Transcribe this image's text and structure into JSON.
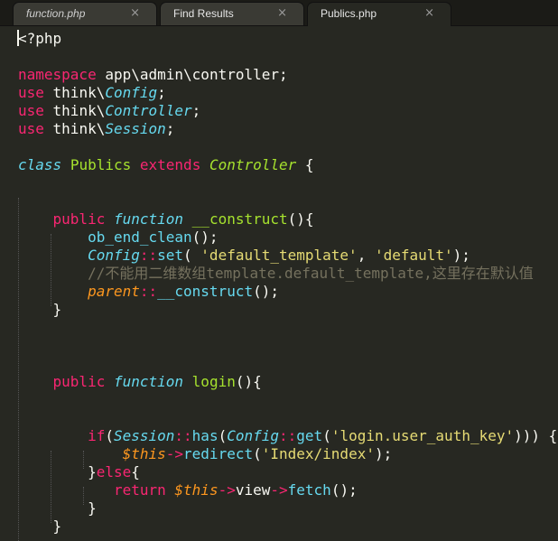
{
  "tabs": [
    {
      "label": "function.php",
      "close": "×"
    },
    {
      "label": "Find Results",
      "close": "×"
    },
    {
      "label": "Publics.php",
      "close": "×"
    }
  ],
  "colors": {
    "background": "#272822",
    "keyword": "#f92672",
    "storage": "#66d9ef",
    "entity": "#a6e22e",
    "string": "#e6db74",
    "comment": "#75715e",
    "variable": "#fd971f",
    "text": "#f8f8f2"
  },
  "code": [
    [
      {
        "t": "<?php",
        "c": "text"
      }
    ],
    [],
    [
      {
        "t": "namespace",
        "c": "keyword"
      },
      {
        "t": " "
      },
      {
        "t": "app\\admin\\controller",
        "c": "text"
      },
      {
        "t": ";"
      }
    ],
    [
      {
        "t": "use",
        "c": "keyword"
      },
      {
        "t": " think\\"
      },
      {
        "t": "Config",
        "c": "storage",
        "i": true
      },
      {
        "t": ";"
      }
    ],
    [
      {
        "t": "use",
        "c": "keyword"
      },
      {
        "t": " think\\"
      },
      {
        "t": "Controller",
        "c": "storage",
        "i": true
      },
      {
        "t": ";"
      }
    ],
    [
      {
        "t": "use",
        "c": "keyword"
      },
      {
        "t": " think\\"
      },
      {
        "t": "Session",
        "c": "storage",
        "i": true
      },
      {
        "t": ";"
      }
    ],
    [],
    [
      {
        "t": "class",
        "c": "storage",
        "i": true
      },
      {
        "t": " "
      },
      {
        "t": "Publics",
        "c": "entity"
      },
      {
        "t": " "
      },
      {
        "t": "extends",
        "c": "keyword"
      },
      {
        "t": " "
      },
      {
        "t": "Controller",
        "c": "entity",
        "i": true
      },
      {
        "t": " {"
      }
    ],
    [],
    [],
    [
      {
        "t": "    "
      },
      {
        "t": "public",
        "c": "keyword"
      },
      {
        "t": " "
      },
      {
        "t": "function",
        "c": "storage",
        "i": true
      },
      {
        "t": " "
      },
      {
        "t": "__construct",
        "c": "entity"
      },
      {
        "t": "(){"
      }
    ],
    [
      {
        "t": "        "
      },
      {
        "t": "ob_end_clean",
        "c": "storage"
      },
      {
        "t": "();"
      }
    ],
    [
      {
        "t": "        "
      },
      {
        "t": "Config",
        "c": "storage",
        "i": true
      },
      {
        "t": "::",
        "c": "keyword"
      },
      {
        "t": "set",
        "c": "storage"
      },
      {
        "t": "( "
      },
      {
        "t": "'default_template'",
        "c": "string"
      },
      {
        "t": ", "
      },
      {
        "t": "'default'",
        "c": "string"
      },
      {
        "t": ");"
      }
    ],
    [
      {
        "t": "        "
      },
      {
        "t": "//不能用二维数组template.default_template,这里存在默认值",
        "c": "comment"
      }
    ],
    [
      {
        "t": "        "
      },
      {
        "t": "parent",
        "c": "variable",
        "i": true
      },
      {
        "t": "::",
        "c": "keyword"
      },
      {
        "t": "__construct",
        "c": "storage"
      },
      {
        "t": "();"
      }
    ],
    [
      {
        "t": "    }"
      }
    ],
    [],
    [],
    [],
    [
      {
        "t": "    "
      },
      {
        "t": "public",
        "c": "keyword"
      },
      {
        "t": " "
      },
      {
        "t": "function",
        "c": "storage",
        "i": true
      },
      {
        "t": " "
      },
      {
        "t": "login",
        "c": "entity"
      },
      {
        "t": "(){"
      }
    ],
    [],
    [],
    [
      {
        "t": "        "
      },
      {
        "t": "if",
        "c": "keyword"
      },
      {
        "t": "("
      },
      {
        "t": "Session",
        "c": "storage",
        "i": true
      },
      {
        "t": "::",
        "c": "keyword"
      },
      {
        "t": "has",
        "c": "storage"
      },
      {
        "t": "("
      },
      {
        "t": "Config",
        "c": "storage",
        "i": true
      },
      {
        "t": "::",
        "c": "keyword"
      },
      {
        "t": "get",
        "c": "storage"
      },
      {
        "t": "("
      },
      {
        "t": "'login.user_auth_key'",
        "c": "string"
      },
      {
        "t": "))) {"
      }
    ],
    [
      {
        "t": "            "
      },
      {
        "t": "$this",
        "c": "variable",
        "i": true
      },
      {
        "t": "->",
        "c": "keyword"
      },
      {
        "t": "redirect",
        "c": "storage"
      },
      {
        "t": "("
      },
      {
        "t": "'Index/index'",
        "c": "string"
      },
      {
        "t": ");"
      }
    ],
    [
      {
        "t": "        }"
      },
      {
        "t": "else",
        "c": "keyword"
      },
      {
        "t": "{"
      }
    ],
    [
      {
        "t": "           "
      },
      {
        "t": "return",
        "c": "keyword"
      },
      {
        "t": " "
      },
      {
        "t": "$this",
        "c": "variable",
        "i": true
      },
      {
        "t": "->",
        "c": "keyword"
      },
      {
        "t": "view",
        "c": "text"
      },
      {
        "t": "->",
        "c": "keyword"
      },
      {
        "t": "fetch",
        "c": "storage"
      },
      {
        "t": "();"
      }
    ],
    [
      {
        "t": "        }"
      }
    ],
    [
      {
        "t": "    }"
      }
    ]
  ]
}
